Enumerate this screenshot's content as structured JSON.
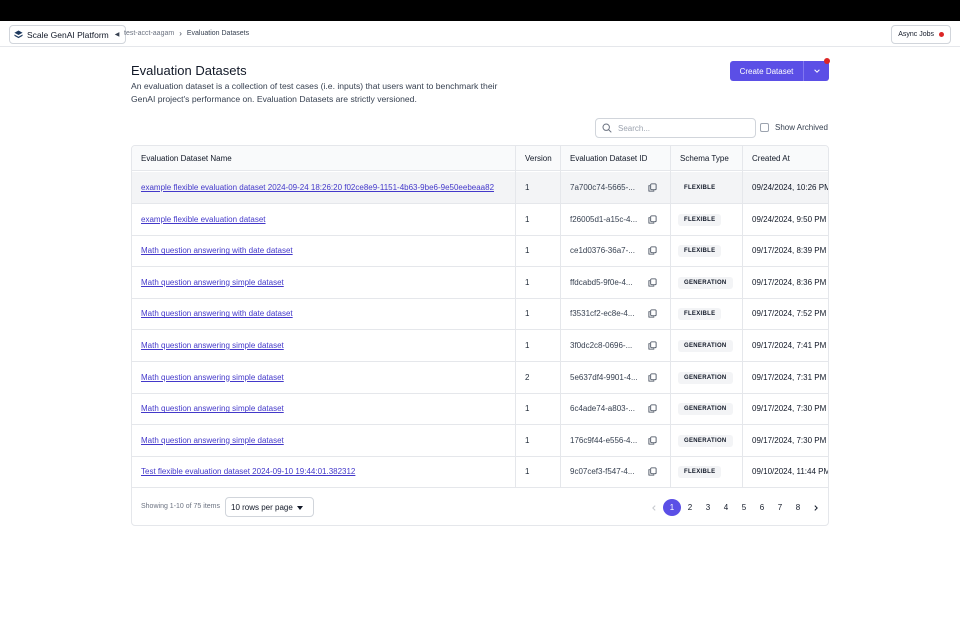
{
  "header": {
    "brand": "Scale GenAI Platform",
    "breadcrumb": [
      "test-acct-aagam",
      "Evaluation Datasets"
    ],
    "async_jobs": "Async Jobs"
  },
  "page": {
    "title": "Evaluation Datasets",
    "description": "An evaluation dataset is a collection of test cases (i.e. inputs) that users want to benchmark their GenAI project's performance on. Evaluation Datasets are strictly versioned.",
    "create_button": "Create Dataset"
  },
  "search": {
    "placeholder": "Search...",
    "value": ""
  },
  "show_archived": "Show Archived",
  "table": {
    "columns": [
      "Evaluation Dataset Name",
      "Version",
      "Evaluation Dataset ID",
      "Schema Type",
      "Created At"
    ],
    "rows": [
      {
        "name": "example flexible evaluation dataset 2024-09-24 18:26:20 f02ce8e9-1151-4b63-9be6-9e50eebeaa82",
        "version": "1",
        "id": "7a700c74-5665-...",
        "schema": "FLEXIBLE",
        "created": "09/24/2024, 10:26 PM"
      },
      {
        "name": "example flexible evaluation dataset",
        "version": "1",
        "id": "f26005d1-a15c-4...",
        "schema": "FLEXIBLE",
        "created": "09/24/2024, 9:50 PM"
      },
      {
        "name": "Math question answering with date dataset",
        "version": "1",
        "id": "ce1d0376-36a7-...",
        "schema": "FLEXIBLE",
        "created": "09/17/2024, 8:39 PM"
      },
      {
        "name": "Math question answering simple dataset",
        "version": "1",
        "id": "ffdcabd5-9f0e-4...",
        "schema": "GENERATION",
        "created": "09/17/2024, 8:36 PM"
      },
      {
        "name": "Math question answering with date dataset",
        "version": "1",
        "id": "f3531cf2-ec8e-4...",
        "schema": "FLEXIBLE",
        "created": "09/17/2024, 7:52 PM"
      },
      {
        "name": "Math question answering simple dataset",
        "version": "1",
        "id": "3f0dc2c8-0696-...",
        "schema": "GENERATION",
        "created": "09/17/2024, 7:41 PM"
      },
      {
        "name": "Math question answering simple dataset",
        "version": "2",
        "id": "5e637df4-9901-4...",
        "schema": "GENERATION",
        "created": "09/17/2024, 7:31 PM"
      },
      {
        "name": "Math question answering simple dataset",
        "version": "1",
        "id": "6c4ade74-a803-...",
        "schema": "GENERATION",
        "created": "09/17/2024, 7:30 PM"
      },
      {
        "name": "Math question answering simple dataset",
        "version": "1",
        "id": "176c9f44-e556-4...",
        "schema": "GENERATION",
        "created": "09/17/2024, 7:30 PM"
      },
      {
        "name": "Test flexible evaluation dataset 2024-09-10 19:44:01.382312",
        "version": "1",
        "id": "9c07cef3-f547-4...",
        "schema": "FLEXIBLE",
        "created": "09/10/2024, 11:44 PM"
      }
    ]
  },
  "footer": {
    "showing": "Showing 1-10 of 75 items",
    "rows_per_page": "10 rows per page",
    "pages": [
      "1",
      "2",
      "3",
      "4",
      "5",
      "6",
      "7",
      "8"
    ],
    "active_page": "1"
  },
  "colors": {
    "accent": "#5b4fe6",
    "link": "#4338ca",
    "alert": "#dc2626"
  },
  "icons": [
    "layers-logo-icon",
    "caret-left-icon",
    "chevron-right-icon",
    "red-dot-icon",
    "chevron-down-icon",
    "search-icon",
    "copy-icon",
    "chevron-left-icon"
  ]
}
